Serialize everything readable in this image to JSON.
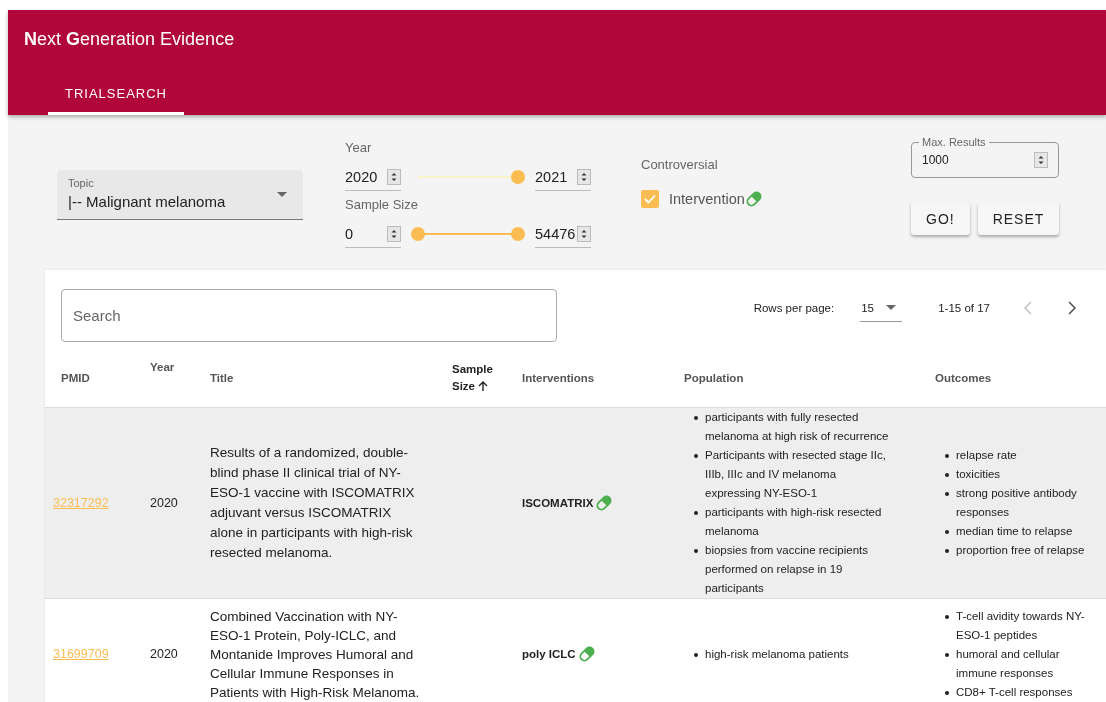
{
  "app_bar": {
    "title": "**N**ext **G**eneration Evidence",
    "tabs": [
      {
        "label": "TRIALSEARCH",
        "selected": true
      }
    ]
  },
  "filters": {
    "topic": {
      "label": "Topic",
      "value": "|-- Malignant melanoma"
    },
    "year": {
      "label": "Year",
      "from": "2020",
      "to": "2021",
      "level": 1,
      "low_thumb": false
    },
    "sample_size": {
      "label": "Sample Size",
      "from": "0",
      "to": "54476",
      "level": 1,
      "low_thumb": true
    },
    "controversial": {
      "label": "Controversial",
      "option": {
        "label": "Intervention",
        "checked": true
      }
    },
    "max_results": {
      "label": "Max. Results",
      "value": "1000"
    },
    "buttons": [
      "GO!",
      "RESET"
    ]
  },
  "search": {
    "placeholder": "Search"
  },
  "pagination": {
    "rows_label": "Rows per page:",
    "rows_value": "15",
    "range": "1-15 of 17",
    "prev_disabled": true,
    "next_disabled": false
  },
  "table": {
    "columns": [
      {
        "label": "PMID",
        "sorted": false
      },
      {
        "label": "Year",
        "sorted": false
      },
      {
        "label": "Title",
        "sorted": false
      },
      {
        "label": "Sample Size",
        "sorted": true
      },
      {
        "label": "Interventions",
        "sorted": false
      },
      {
        "label": "Population",
        "sorted": false
      },
      {
        "label": "Outcomes",
        "sorted": false
      }
    ],
    "rows": [
      {
        "selected": true,
        "pmid": "32317292",
        "year": "2020",
        "title": "Results of a randomized, double-blind phase II clinical trial of NY-ESO-1 vaccine with ISCOMATRIX adjuvant versus ISCOMATRIX alone in participants with high-risk resected melanoma.",
        "interventions": [
          "ISCOMATRIX"
        ],
        "population": [
          "participants with fully resected melanoma at high risk of recurrence",
          "Participants with resected stage IIc, IIIb, IIIc and IV melanoma expressing NY-ESO-1",
          "participants with high-risk resected melanoma",
          "biopsies from vaccine recipients performed on relapse in 19 participants"
        ],
        "outcomes": [
          "relapse rate",
          "toxicities",
          "strong positive antibody responses",
          "median time to relapse",
          "proportion free of relapse"
        ]
      },
      {
        "selected": false,
        "pmid": "31699709",
        "year": "2020",
        "title": "Combined Vaccination with NY-ESO-1 Protein, Poly-ICLC, and Montanide Improves Humoral and Cellular Immune Responses in Patients with High-Risk Melanoma.",
        "interventions": [
          "poly ICLC"
        ],
        "population": [
          "high-risk melanoma patients"
        ],
        "outcomes": [
          "T-cell avidity towards NY-ESO-1 peptides",
          "humoral and cellular immune responses",
          "CD8+ T-cell responses"
        ]
      }
    ]
  }
}
